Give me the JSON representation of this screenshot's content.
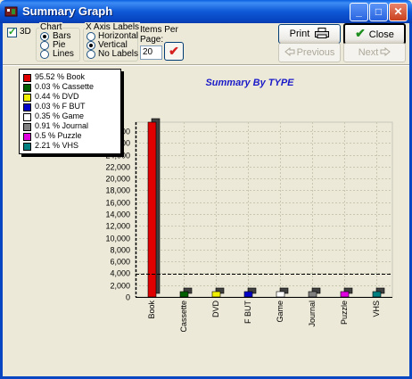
{
  "window": {
    "title": "Summary Graph",
    "controls": {
      "minimize": "_",
      "maximize": "□",
      "close": "✕"
    }
  },
  "toolbar": {
    "three_d": {
      "label": "3D",
      "checked": true
    },
    "chart": {
      "label": "Chart",
      "options": [
        "Bars",
        "Pie",
        "Lines"
      ],
      "selected": "Bars"
    },
    "x_axis_labels": {
      "label": "X Axis Labels",
      "options": [
        "Horizontal",
        "Vertical",
        "No Labels"
      ],
      "selected": "Vertical"
    },
    "items_per_page": {
      "label_line1": "Items Per",
      "label_line2": "Page:",
      "value": "20"
    },
    "print_label": "Print",
    "close_label": "Close",
    "previous_label": "Previous",
    "next_label": "Next"
  },
  "legend": [
    {
      "text": "95.52 % Book",
      "color": "#E00000"
    },
    {
      "text": "0.03 % Cassette",
      "color": "#006000"
    },
    {
      "text": "0.44 % DVD",
      "color": "#F0F000"
    },
    {
      "text": "0.03 % F BUT",
      "color": "#0000C8"
    },
    {
      "text": "0.35 % Game",
      "color": "#FFFFFF"
    },
    {
      "text": "0.91 % Journal",
      "color": "#808080"
    },
    {
      "text": "0.5 % Puzzle",
      "color": "#E000E0"
    },
    {
      "text": "2.21 % VHS",
      "color": "#008080"
    }
  ],
  "chart_data": {
    "type": "bar",
    "title": "Summary By TYPE",
    "categories": [
      "Book",
      "Cassette",
      "DVD",
      "F BUT",
      "Game",
      "Journal",
      "Puzzle",
      "VHS"
    ],
    "values": [
      29500,
      9,
      135,
      9,
      107,
      278,
      153,
      675
    ],
    "colors": [
      "#E00000",
      "#006000",
      "#F0F000",
      "#0000C8",
      "#FFFFFF",
      "#808080",
      "#E000E0",
      "#008080"
    ],
    "yticks": [
      0,
      2000,
      4000,
      6000,
      8000,
      10000,
      12000,
      14000,
      16000,
      18000,
      20000,
      22000,
      24000,
      26000,
      28000
    ],
    "ytick_labels": [
      "0",
      "2,000",
      "4,000",
      "6,000",
      "8,000",
      "10,000",
      "12,000",
      "14,000",
      "16,000",
      "18,000",
      "20,000",
      "22,000",
      "24,000",
      "26,000",
      "28,000"
    ],
    "ylim": [
      0,
      29500
    ],
    "x_label_orientation": "vertical",
    "three_d": true,
    "grid": true,
    "average_line": true
  }
}
